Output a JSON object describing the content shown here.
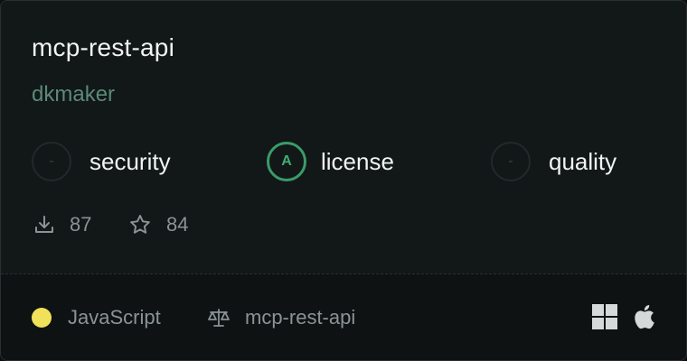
{
  "card": {
    "title": "mcp-rest-api",
    "author": "dkmaker"
  },
  "scores": [
    {
      "grade": "-",
      "label": "security",
      "graded": false
    },
    {
      "grade": "A",
      "label": "license",
      "graded": true,
      "color": "#3a9b6a"
    },
    {
      "grade": "-",
      "label": "quality",
      "graded": false
    }
  ],
  "stats": {
    "downloads": "87",
    "stars": "84"
  },
  "footer": {
    "language": "JavaScript",
    "language_color": "#f1e05a",
    "license_name": "mcp-rest-api",
    "platforms": [
      "windows-icon",
      "apple-icon"
    ]
  }
}
